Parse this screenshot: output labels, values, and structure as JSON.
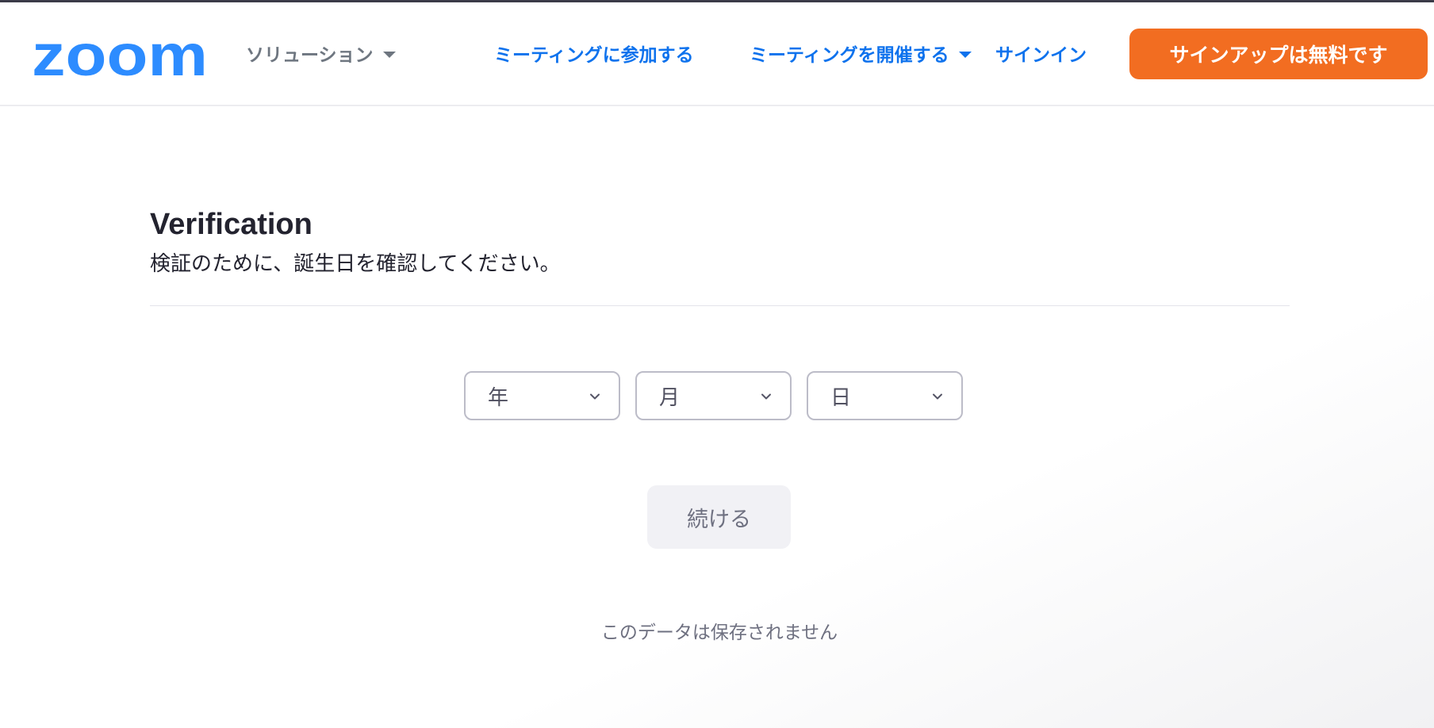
{
  "header": {
    "logo_text": "zoom",
    "nav": {
      "solutions": "ソリューション",
      "join_meeting": "ミーティングに参加する",
      "host_meeting": "ミーティングを開催する",
      "sign_in": "サインイン"
    },
    "signup_label": "サインアップは無料です"
  },
  "verification": {
    "title": "Verification",
    "subtitle": "検証のために、誕生日を確認してください。",
    "year_label": "年",
    "month_label": "月",
    "day_label": "日",
    "continue_label": "続ける",
    "note": "このデータは保存されません"
  },
  "colors": {
    "brand_blue": "#0e72ed",
    "logo_blue": "#2d8cff",
    "signup_orange": "#f26d21",
    "nav_gray": "#6e7680"
  },
  "icons": {
    "dropdown": "caret-down-icon",
    "select": "chevron-down-icon"
  }
}
